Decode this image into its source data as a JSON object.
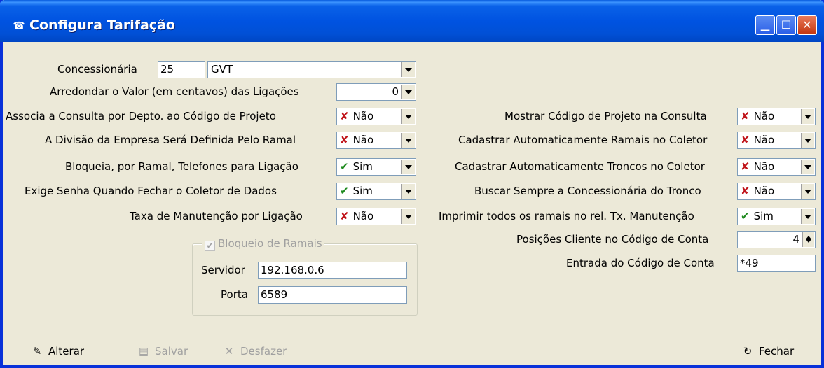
{
  "window": {
    "title": "Configura Tarifação",
    "icon": "app-icon",
    "controls": [
      "minimize",
      "maximize",
      "close"
    ]
  },
  "concessionaria": {
    "label": "Concessionária",
    "code": "25",
    "name": "GVT"
  },
  "left_fields": [
    {
      "label": "Arredondar o Valor (em centavos) das Ligações",
      "value": "0"
    },
    {
      "label": "Associa a Consulta por Depto. ao Código de Projeto",
      "value": "Não"
    },
    {
      "label": "A Divisão da Empresa Será Definida Pelo Ramal",
      "value": "Não"
    },
    {
      "label": "Bloqueia, por Ramal, Telefones para Ligação",
      "value": "Sim"
    },
    {
      "label": "Exige Senha Quando Fechar o Coletor de Dados",
      "value": "Sim"
    },
    {
      "label": "Taxa de Manutenção por Ligação",
      "value": "Não"
    }
  ],
  "right_fields": [
    {
      "label": "Mostrar Código de Projeto na Consulta",
      "value": "Não"
    },
    {
      "label": "Cadastrar Automaticamente Ramais no Coletor",
      "value": "Não"
    },
    {
      "label": "Cadastrar Automaticamente Troncos no Coletor",
      "value": "Não"
    },
    {
      "label": "Buscar Sempre a Concessionária do Tronco",
      "value": "Não"
    },
    {
      "label": "Imprimir todos os ramais no rel. Tx. Manutenção",
      "value": "Sim"
    },
    {
      "label": "Posições Cliente no Código de Conta",
      "value": "4"
    },
    {
      "label": "Entrada do Código de Conta",
      "value": "*49"
    }
  ],
  "bloqueio": {
    "title": "Bloqueio de Ramais",
    "checked": true,
    "servidor_label": "Servidor",
    "servidor": "192.168.0.6",
    "porta_label": "Porta",
    "porta": "6589"
  },
  "toolbar": {
    "alterar": "Alterar",
    "salvar": "Salvar",
    "desfazer": "Desfazer",
    "fechar": "Fechar"
  },
  "colors": {
    "no": "#c0141a",
    "yes": "#1e8a1e",
    "title_bar": "#0053e1"
  }
}
